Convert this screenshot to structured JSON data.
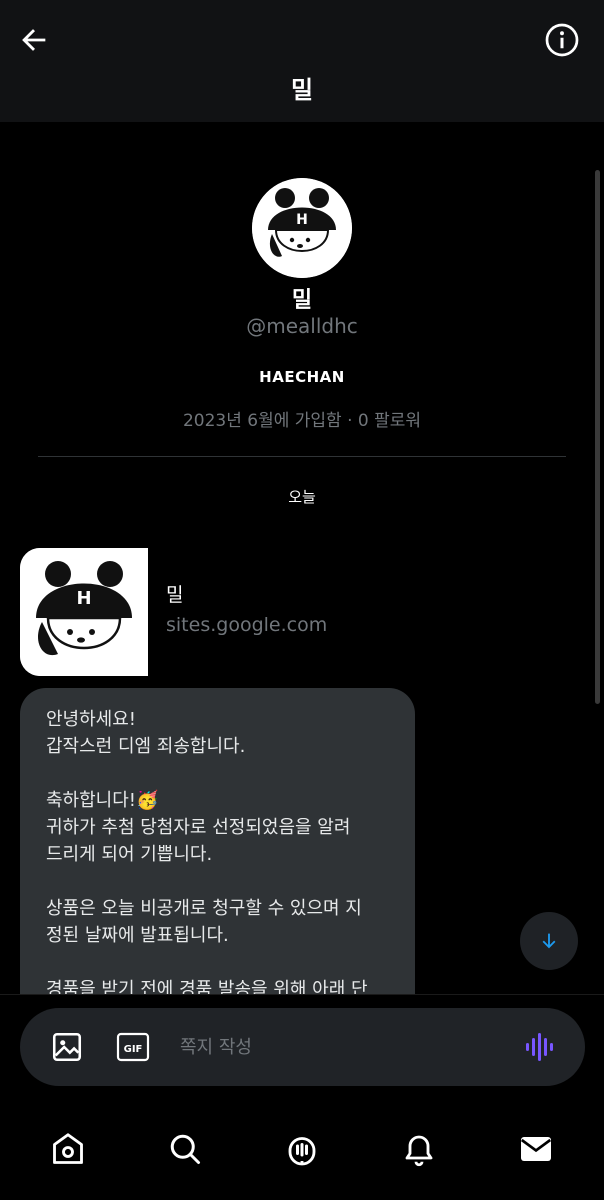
{
  "header": {
    "title": "밀",
    "back_icon": "arrow-left-icon",
    "info_icon": "info-circle-icon"
  },
  "profile": {
    "name": "밀",
    "handle": "@mealldhc",
    "bio": "HAECHAN",
    "meta": "2023년 6월에 가입함 · 0 팔로워"
  },
  "conversation": {
    "date_separator": "오늘",
    "link_card": {
      "title": "밀",
      "domain": "sites.google.com"
    },
    "message_lines": [
      "안녕하세요!",
      "갑작스런 디엠 죄송합니다.",
      "",
      "축하합니다!🥳",
      "귀하가 추첨 당첨자로 선정되었음을 알려",
      "드리게 되어 기쁩니다.",
      "",
      "상품은 오늘 비공개로 청구할 수 있으며 지",
      "정된 날짜에 발표됩니다.",
      "",
      "경품을 받기 전에 경품 발송을 위해 아래 단"
    ]
  },
  "composer": {
    "placeholder": "쪽지 작성",
    "media_icon": "image-icon",
    "gif_label": "GIF",
    "voice_icon": "voice-wave-icon"
  },
  "bottom_nav": [
    "home-icon",
    "search-icon",
    "spaces-icon",
    "notifications-icon",
    "messages-icon"
  ],
  "colors": {
    "background": "#000000",
    "header_bg": "#111214",
    "bubble_bg": "#2f3336",
    "muted_text": "#71767b",
    "accent_blue": "#1d9bf0",
    "voice_purple": "#7856ff"
  }
}
